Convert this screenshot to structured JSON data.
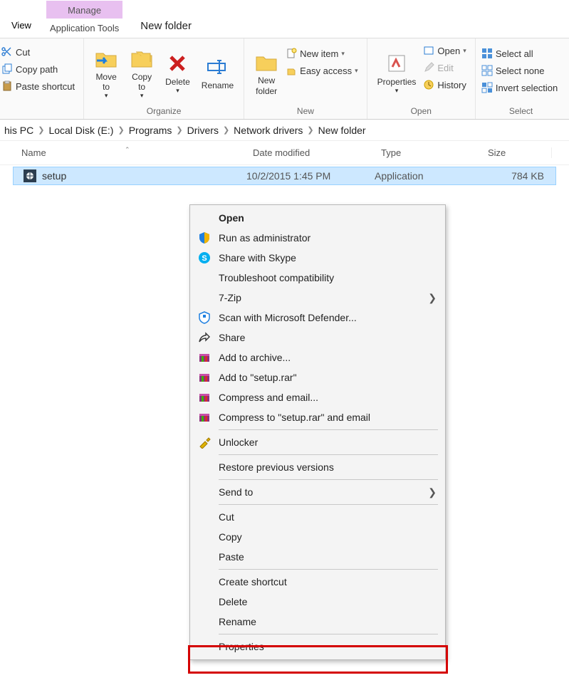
{
  "tabs": {
    "view": "View",
    "manage": "Manage",
    "app_tools": "Application Tools",
    "title": "New folder"
  },
  "ribbon": {
    "clipboard": {
      "cut": "Cut",
      "copy_path": "Copy path",
      "paste_shortcut": "Paste shortcut"
    },
    "organize": {
      "move_to": "Move\nto",
      "copy_to": "Copy\nto",
      "delete": "Delete",
      "rename": "Rename",
      "label": "Organize"
    },
    "new": {
      "new_folder": "New\nfolder",
      "new_item": "New item",
      "easy_access": "Easy access",
      "label": "New"
    },
    "open": {
      "properties": "Properties",
      "open": "Open",
      "edit": "Edit",
      "history": "History",
      "label": "Open"
    },
    "select": {
      "select_all": "Select all",
      "select_none": "Select none",
      "invert": "Invert selection",
      "label": "Select"
    }
  },
  "breadcrumb": [
    "his PC",
    "Local Disk (E:)",
    "Programs",
    "Drivers",
    "Network drivers",
    "New folder"
  ],
  "columns": {
    "name": "Name",
    "date": "Date modified",
    "type": "Type",
    "size": "Size"
  },
  "file": {
    "name": "setup",
    "date": "10/2/2015 1:45 PM",
    "type": "Application",
    "size": "784 KB"
  },
  "context_menu": {
    "open": "Open",
    "run_admin": "Run as administrator",
    "share_skype": "Share with Skype",
    "troubleshoot": "Troubleshoot compatibility",
    "sevenzip": "7-Zip",
    "scan_defender": "Scan with Microsoft Defender...",
    "share": "Share",
    "add_archive": "Add to archive...",
    "add_setup_rar": "Add to \"setup.rar\"",
    "compress_email": "Compress and email...",
    "compress_setup_email": "Compress to \"setup.rar\" and email",
    "unlocker": "Unlocker",
    "restore_prev": "Restore previous versions",
    "send_to": "Send to",
    "cut": "Cut",
    "copy": "Copy",
    "paste": "Paste",
    "create_shortcut": "Create shortcut",
    "delete": "Delete",
    "rename": "Rename",
    "properties": "Properties"
  }
}
